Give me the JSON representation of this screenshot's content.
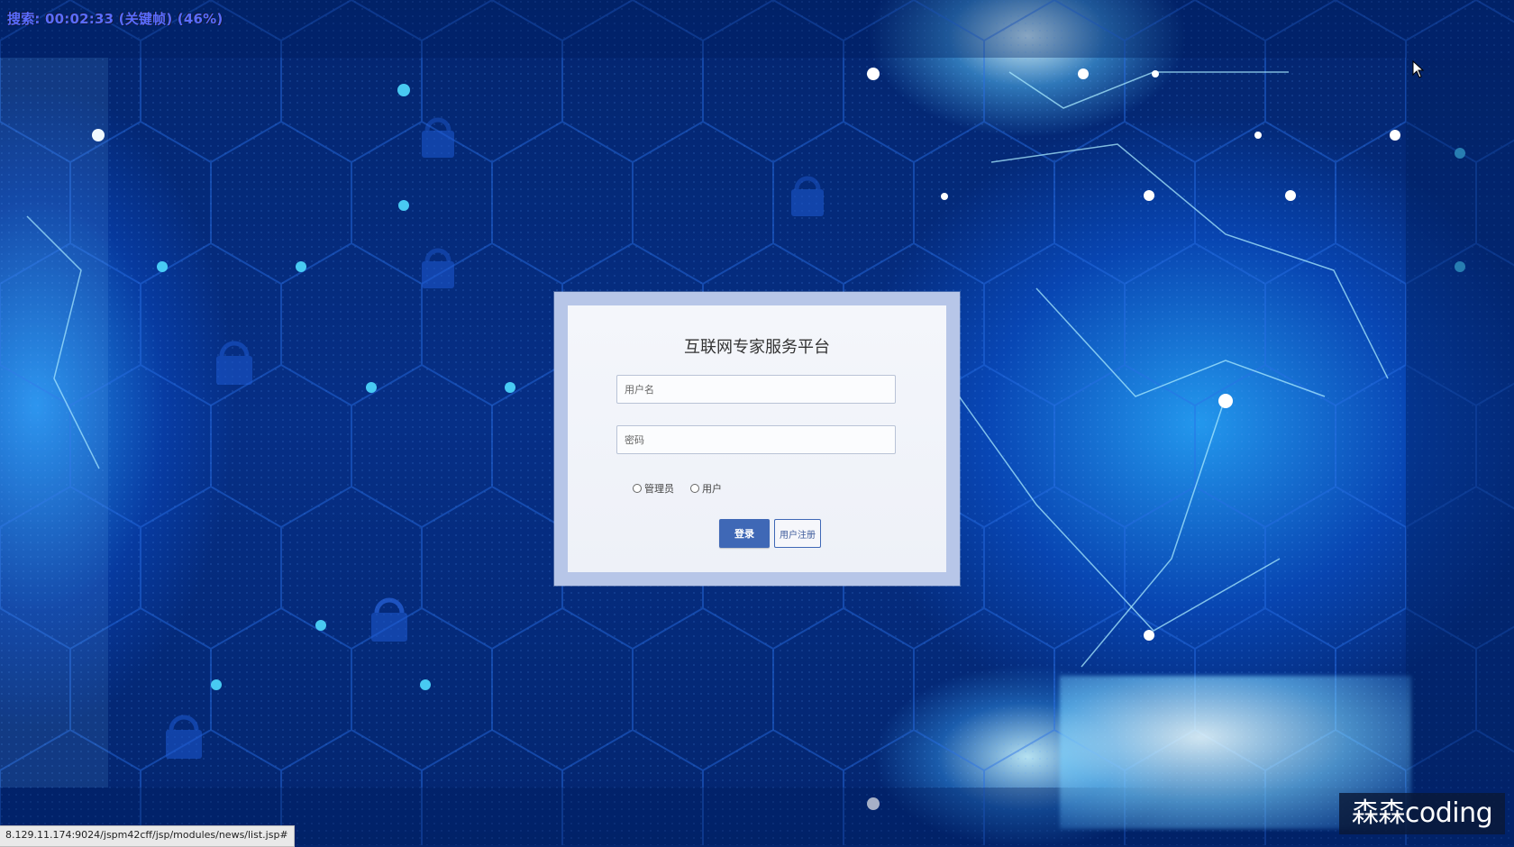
{
  "overlay": {
    "recorder_text": "搜索: 00:02:33 (关键帧) (46%)"
  },
  "login": {
    "title": "互联网专家服务平台",
    "username_placeholder": "用户名",
    "password_placeholder": "密码",
    "roles": [
      {
        "label": "管理员",
        "selected": false
      },
      {
        "label": "用户",
        "selected": false
      }
    ],
    "login_button": "登录",
    "register_button": "用户注册"
  },
  "status_bar": {
    "url": "8.129.11.174:9024/jspm42cff/jsp/modules/news/list.jsp#"
  },
  "watermark": {
    "text": "森森coding"
  },
  "colors": {
    "background": "#03256e",
    "primary_button": "#3f68b6",
    "dialog_frame": "#b7c6e8"
  }
}
